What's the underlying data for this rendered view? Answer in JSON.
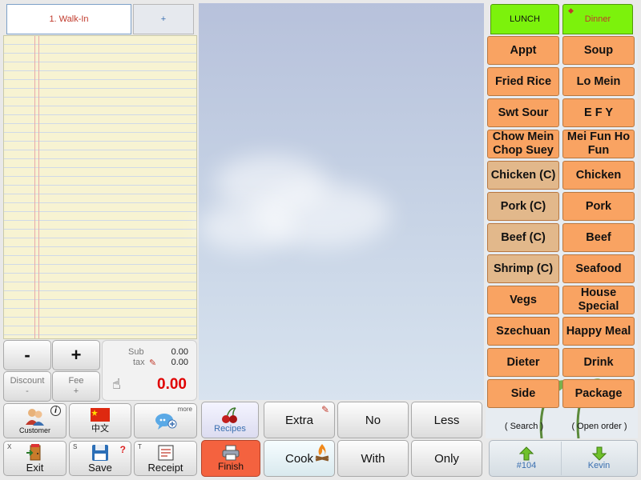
{
  "ticket_tabs": {
    "active": "1. Walk-In",
    "add": "+"
  },
  "keypad": {
    "minus": "-",
    "plus": "+",
    "discount_label": "Discount",
    "discount_sub": "-",
    "fee_label": "Fee",
    "fee_sub": "+"
  },
  "totals": {
    "sub_label": "Sub",
    "sub_value": "0.00",
    "tax_label": "tax",
    "tax_value": "0.00",
    "total": "0.00"
  },
  "left_buttons": {
    "customer": "Customer",
    "language": "中文",
    "more": "more",
    "exit_key": "X",
    "exit": "Exit",
    "save_key": "S",
    "save": "Save",
    "receipt_key": "T",
    "receipt": "Receipt"
  },
  "bottom_bar": {
    "recipes": "Recipes",
    "finish": "Finish",
    "extra": "Extra",
    "no": "No",
    "less": "Less",
    "cook": "Cook",
    "with": "With",
    "only": "Only"
  },
  "meal_tabs": {
    "lunch": "LUNCH",
    "dinner": "Dinner"
  },
  "menu_items": [
    {
      "label": "Appt",
      "style": "orange"
    },
    {
      "label": "Soup",
      "style": "orange"
    },
    {
      "label": "Fried Rice",
      "style": "orange"
    },
    {
      "label": "Lo Mein",
      "style": "orange"
    },
    {
      "label": "Swt Sour",
      "style": "orange"
    },
    {
      "label": "E F Y",
      "style": "orange"
    },
    {
      "label": "Chow Mein Chop Suey",
      "style": "orange"
    },
    {
      "label": "Mei Fun Ho Fun",
      "style": "orange"
    },
    {
      "label": "Chicken (C)",
      "style": "tan"
    },
    {
      "label": "Chicken",
      "style": "orange"
    },
    {
      "label": "Pork (C)",
      "style": "tan"
    },
    {
      "label": "Pork",
      "style": "orange"
    },
    {
      "label": "Beef (C)",
      "style": "tan"
    },
    {
      "label": "Beef",
      "style": "orange"
    },
    {
      "label": "Shrimp (C)",
      "style": "tan"
    },
    {
      "label": "Seafood",
      "style": "orange"
    },
    {
      "label": "Vegs",
      "style": "orange"
    },
    {
      "label": "House Special",
      "style": "orange"
    },
    {
      "label": "Szechuan",
      "style": "orange"
    },
    {
      "label": "Happy Meal",
      "style": "orange"
    },
    {
      "label": "Dieter",
      "style": "orange"
    },
    {
      "label": "Drink",
      "style": "orange"
    },
    {
      "label": "Side",
      "style": "orange"
    },
    {
      "label": "Package",
      "style": "orange"
    }
  ],
  "links": {
    "search": "( Search )",
    "open_order": "( Open order )"
  },
  "footer": {
    "table": "#104",
    "server": "Kevin"
  },
  "colors": {
    "tab_green": "#7cf20c",
    "finish_red": "#f4623f",
    "menu_orange": "#f9a362",
    "menu_tan": "#e2b88b",
    "total_red": "#e00000"
  }
}
